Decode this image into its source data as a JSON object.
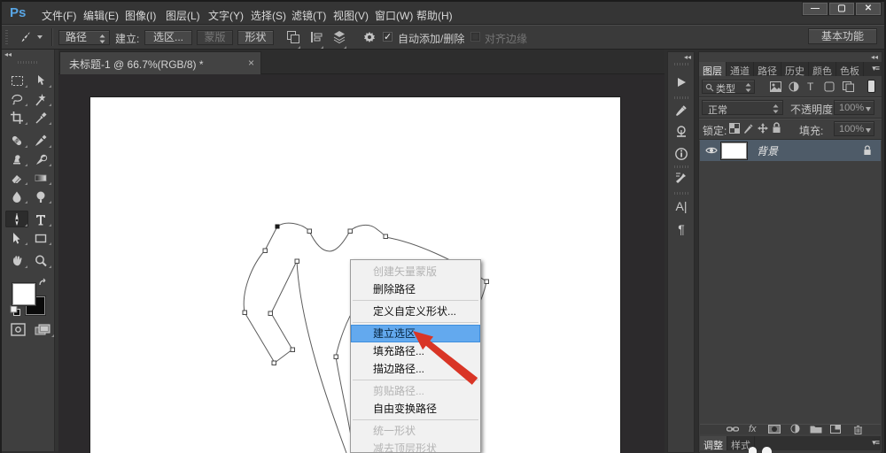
{
  "app": {
    "logo": "Ps",
    "window_controls": {
      "minimize": "—",
      "maximize": "▢",
      "close": "✕"
    }
  },
  "menu_bar": {
    "items": [
      "文件(F)",
      "编辑(E)",
      "图像(I)",
      "图层(L)",
      "文字(Y)",
      "选择(S)",
      "滤镜(T)",
      "视图(V)",
      "窗口(W)",
      "帮助(H)"
    ]
  },
  "options_bar": {
    "tool_mode_value": "路径",
    "make_label": "建立:",
    "selection_button": "选区...",
    "mask_button": "蒙版",
    "shape_button": "形状",
    "auto_add_delete_label": "自动添加/删除",
    "auto_add_delete_checked": "✓",
    "align_edges_label": "对齐边缘",
    "workspace_button": "基本功能"
  },
  "document_tab": {
    "title": "未标题-1 @ 66.7%(RGB/8) *",
    "close": "×"
  },
  "icons": {
    "collapse_arrows": "◂◂",
    "panel_menu": "▾≡",
    "character_panel": "A|",
    "paragraph_panel": "¶",
    "fx": "fx",
    "type_filter": "T"
  },
  "context_menu": {
    "items": [
      {
        "label": "创建矢量蒙版",
        "state": "disabled"
      },
      {
        "label": "删除路径",
        "state": "normal"
      },
      {
        "label": "定义自定义形状...",
        "state": "normal"
      },
      {
        "label": "建立选区...",
        "state": "highlighted"
      },
      {
        "label": "填充路径...",
        "state": "normal"
      },
      {
        "label": "描边路径...",
        "state": "normal"
      },
      {
        "label": "剪贴路径...",
        "state": "disabled"
      },
      {
        "label": "自由变换路径",
        "state": "normal"
      },
      {
        "label": "统一形状",
        "state": "disabled"
      },
      {
        "label": "减去顶层形状",
        "state": "disabled"
      }
    ]
  },
  "layers_panel": {
    "tabs": [
      "图层",
      "通道",
      "路径",
      "历史",
      "颜色",
      "色板"
    ],
    "active_tab": "图层",
    "filter_kind_value": "类型",
    "blend_mode_value": "正常",
    "opacity_label": "不透明度:",
    "opacity_value": "100%",
    "lock_label": "锁定:",
    "fill_label": "填充:",
    "fill_value": "100%",
    "layers": [
      {
        "name": "背景",
        "visible": true,
        "locked": true,
        "selected": true
      }
    ]
  },
  "bottom_panel_group": {
    "tabs": [
      "调整",
      "样式"
    ],
    "active_tab": "调整"
  },
  "colors": {
    "accent_blue_logo": "#58a5e4",
    "menu_highlight": "#63a9ee",
    "selected_layer_row": "#4e5b68",
    "arrow_red": "#d93526",
    "panel_bg": "#3f3f3f",
    "canvas_bg": "#2c2a2c"
  }
}
